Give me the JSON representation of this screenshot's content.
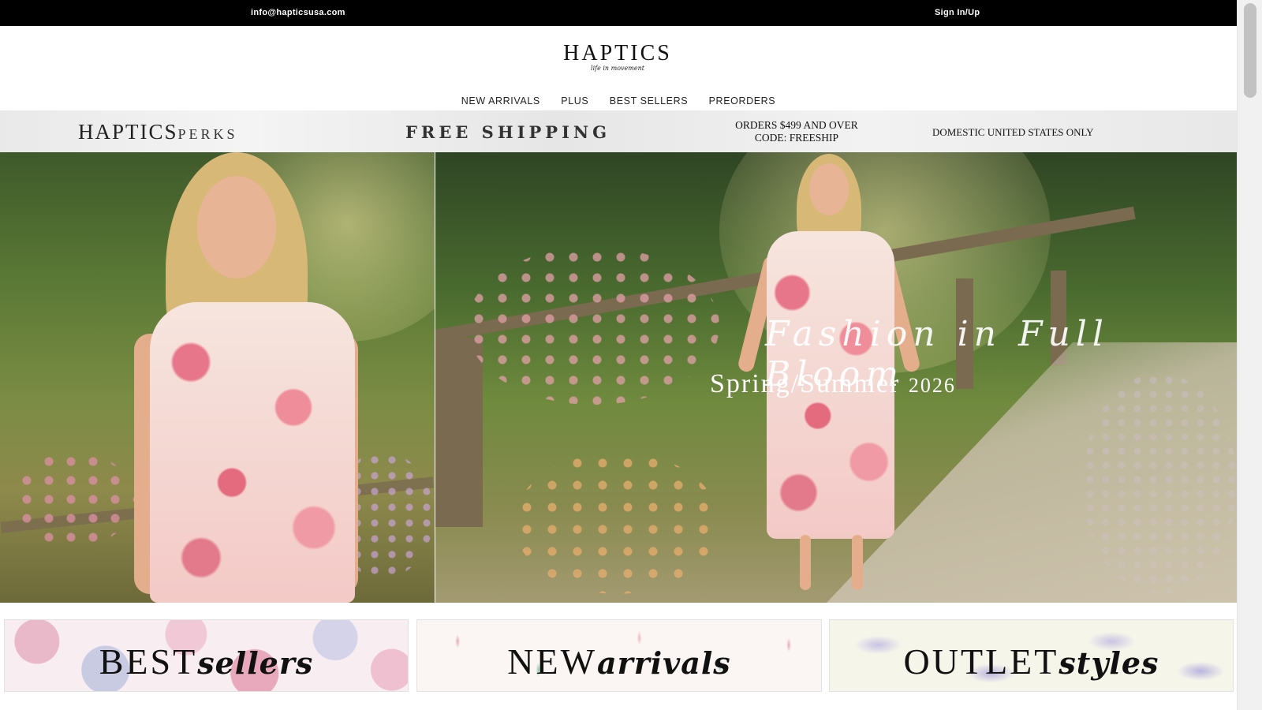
{
  "topbar": {
    "email": "info@hapticsusa.com",
    "sign_in": "Sign In/Up"
  },
  "header": {
    "brand": "HAPTICS",
    "tagline": "life in movement"
  },
  "nav": {
    "items": [
      "NEW ARRIVALS",
      "PLUS",
      "BEST SELLERS",
      "PREORDERS"
    ]
  },
  "perks": {
    "logo_main": "HAPTICS",
    "logo_sub": "PERKS",
    "free_shipping": "FREE SHIPPING",
    "orders_line1": "ORDERS $499 AND OVER",
    "orders_line2": "CODE: FREESHIP",
    "domestic": "DOMESTIC UNITED STATES ONLY"
  },
  "hero": {
    "title": "Fashion in Full Bloom",
    "subtitle": "Spring/Summer",
    "year": "2026"
  },
  "categories": [
    {
      "big": "BEST",
      "script": "sellers"
    },
    {
      "big": "NEW",
      "script": "arrivals"
    },
    {
      "big": "OUTLET",
      "script": "styles"
    }
  ]
}
